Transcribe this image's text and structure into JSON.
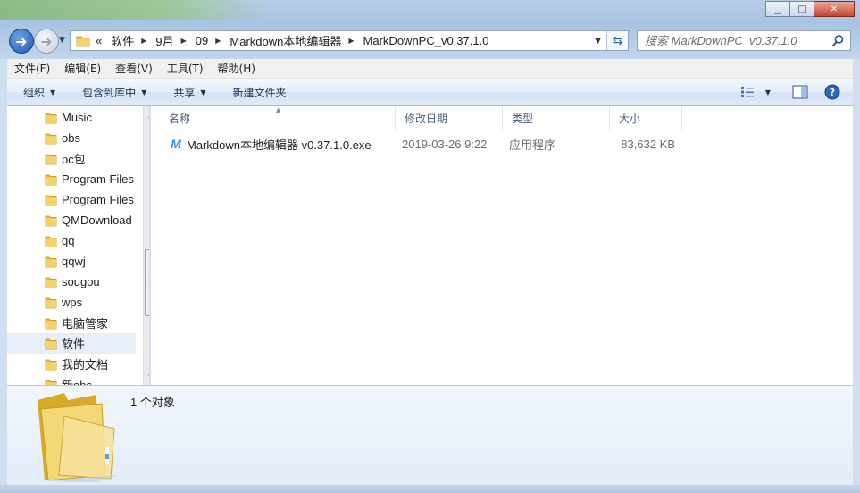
{
  "window": {
    "minimize_glyph": "▁",
    "maximize_glyph": "□",
    "close_glyph": "✕"
  },
  "address_bar": {
    "overflow": "«",
    "crumbs": [
      "软件",
      "9月",
      "09",
      "Markdown本地编辑器",
      "MarkDownPC_v0.37.1.0"
    ]
  },
  "search": {
    "placeholder": "搜索 MarkDownPC_v0.37.1.0"
  },
  "menu": [
    "文件(F)",
    "编辑(E)",
    "查看(V)",
    "工具(T)",
    "帮助(H)"
  ],
  "toolbar": {
    "organize": "组织",
    "include_in_library": "包含到库中",
    "share": "共享",
    "new_folder": "新建文件夹"
  },
  "nav_pane": {
    "items": [
      "Music",
      "obs",
      "pc包",
      "Program Files",
      "Program Files",
      "QMDownload",
      "qq",
      "qqwj",
      "sougou",
      "wps",
      "电脑管家",
      "软件",
      "我的文档",
      "新obs"
    ],
    "selected_index": 11
  },
  "columns": {
    "name": "名称",
    "modified": "修改日期",
    "type": "类型",
    "size": "大小"
  },
  "files": [
    {
      "name": "Markdown本地编辑器 v0.37.1.0.exe",
      "modified": "2019-03-26 9:22",
      "type": "应用程序",
      "size": "83,632 KB",
      "icon": "markdown-app-icon"
    }
  ],
  "details": {
    "count": "1 个对象"
  },
  "colors": {
    "folder": "#e8b93a",
    "accent": "#1e56b0",
    "selection": "#e5eef9"
  }
}
